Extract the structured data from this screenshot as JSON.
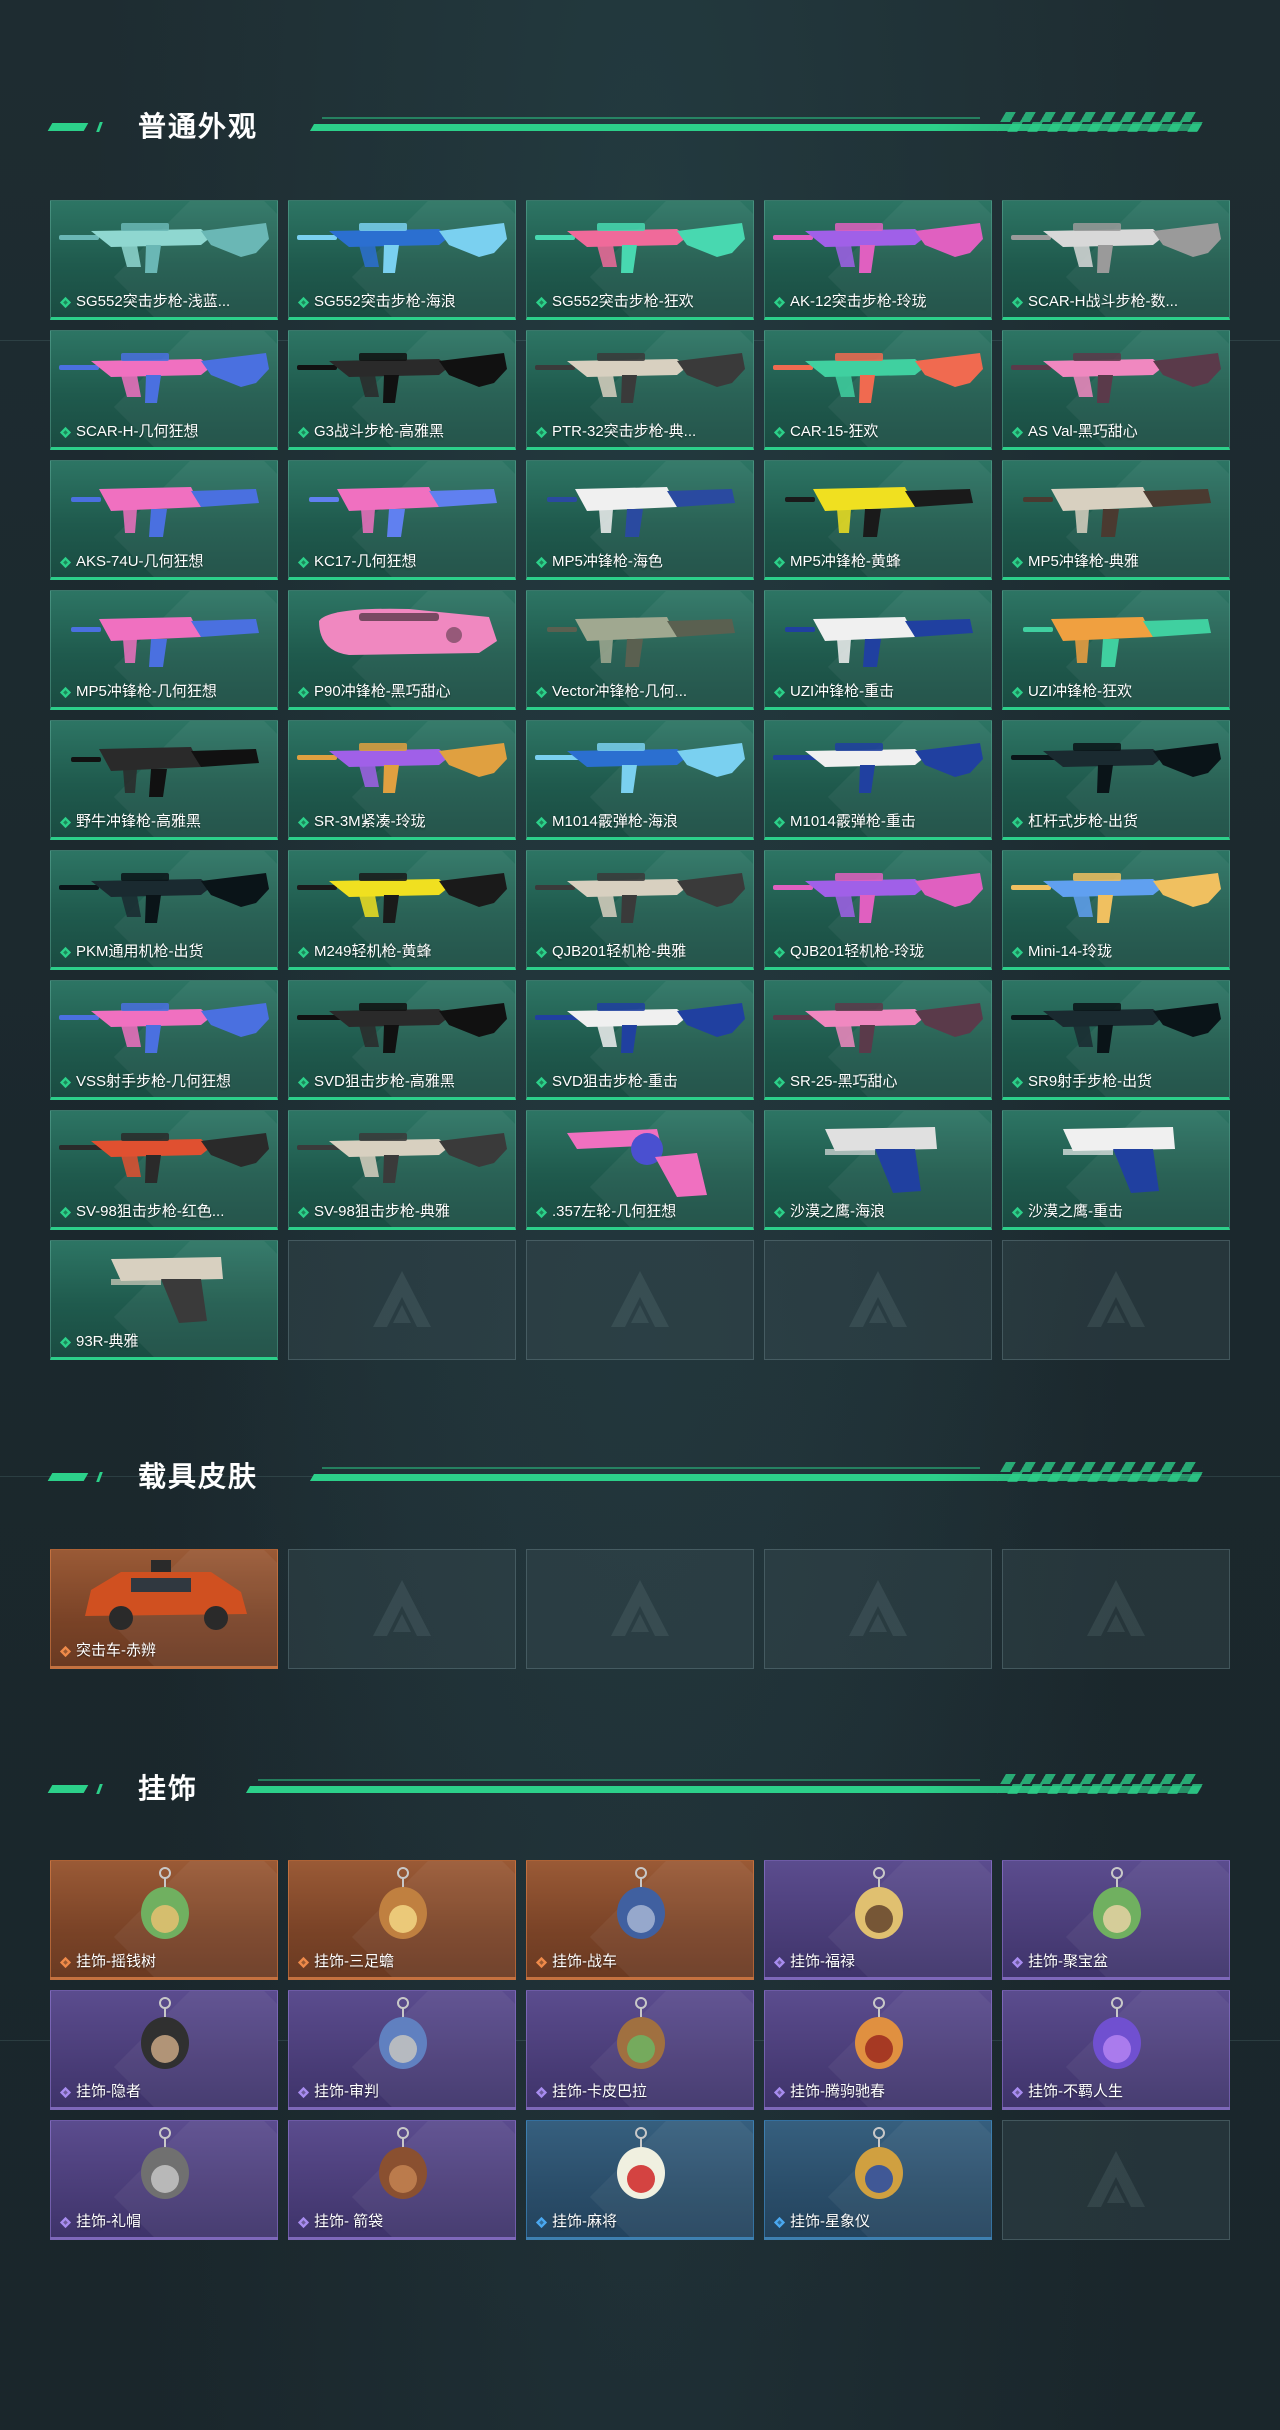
{
  "sections": [
    {
      "title": "普通外观",
      "items": [
        {
          "label": "SG552突击步枪-浅蓝...",
          "rarity": "green",
          "art": "rifle",
          "c1": "#8fd7d0",
          "c2": "#6ab7b5"
        },
        {
          "label": "SG552突击步枪-海浪",
          "rarity": "green",
          "art": "rifle",
          "c1": "#2b6fd0",
          "c2": "#7ad0f0"
        },
        {
          "label": "SG552突击步枪-狂欢",
          "rarity": "green",
          "art": "rifle",
          "c1": "#f06a9a",
          "c2": "#48d8b0"
        },
        {
          "label": "AK-12突击步枪-玲珑",
          "rarity": "green",
          "art": "rifle",
          "c1": "#a060e8",
          "c2": "#e060c0"
        },
        {
          "label": "SCAR-H战斗步枪-数...",
          "rarity": "green",
          "art": "rifle",
          "c1": "#d8d8d8",
          "c2": "#9a9a9a"
        },
        {
          "label": "SCAR-H-几何狂想",
          "rarity": "green",
          "art": "rifle",
          "c1": "#f070c0",
          "c2": "#4a70e0"
        },
        {
          "label": "G3战斗步枪-高雅黑",
          "rarity": "green",
          "art": "rifle",
          "c1": "#2a2a2a",
          "c2": "#111111"
        },
        {
          "label": "PTR-32突击步枪-典...",
          "rarity": "green",
          "art": "rifle",
          "c1": "#d8d0c0",
          "c2": "#3a3a3a"
        },
        {
          "label": "CAR-15-狂欢",
          "rarity": "green",
          "art": "rifle",
          "c1": "#40d0a0",
          "c2": "#f06a50"
        },
        {
          "label": "AS Val-黑巧甜心",
          "rarity": "green",
          "art": "rifle",
          "c1": "#f088c0",
          "c2": "#5a3a4a"
        },
        {
          "label": "AKS-74U-几何狂想",
          "rarity": "green",
          "art": "smg",
          "c1": "#f070c0",
          "c2": "#4a70e0"
        },
        {
          "label": "KC17-几何狂想",
          "rarity": "green",
          "art": "smg",
          "c1": "#f070c0",
          "c2": "#6080f0"
        },
        {
          "label": "MP5冲锋枪-海色",
          "rarity": "green",
          "art": "smg",
          "c1": "#f0f0f0",
          "c2": "#2a4aa0"
        },
        {
          "label": "MP5冲锋枪-黄蜂",
          "rarity": "green",
          "art": "smg",
          "c1": "#f0e020",
          "c2": "#1a1a1a"
        },
        {
          "label": "MP5冲锋枪-典雅",
          "rarity": "green",
          "art": "smg",
          "c1": "#d8d0c0",
          "c2": "#4a3a30"
        },
        {
          "label": "MP5冲锋枪-几何狂想",
          "rarity": "green",
          "art": "smg",
          "c1": "#f070c0",
          "c2": "#4a70e0"
        },
        {
          "label": "P90冲锋枪-黑巧甜心",
          "rarity": "green",
          "art": "p90",
          "c1": "#f088c0",
          "c2": "#5a3a4a"
        },
        {
          "label": "Vector冲锋枪-几何...",
          "rarity": "green",
          "art": "smg",
          "c1": "#a0a890",
          "c2": "#5a6050"
        },
        {
          "label": "UZI冲锋枪-重击",
          "rarity": "green",
          "art": "smg",
          "c1": "#f0f0f0",
          "c2": "#2040a0"
        },
        {
          "label": "UZI冲锋枪-狂欢",
          "rarity": "green",
          "art": "smg",
          "c1": "#f0a040",
          "c2": "#40d0a0"
        },
        {
          "label": "野牛冲锋枪-高雅黑",
          "rarity": "green",
          "art": "smg",
          "c1": "#2a2a2a",
          "c2": "#111111"
        },
        {
          "label": "SR-3M紧凑-玲珑",
          "rarity": "green",
          "art": "rifle",
          "c1": "#a060e8",
          "c2": "#e0a040"
        },
        {
          "label": "M1014霰弹枪-海浪",
          "rarity": "green",
          "art": "shotgun",
          "c1": "#2b6fd0",
          "c2": "#7ad0f0"
        },
        {
          "label": "M1014霰弹枪-重击",
          "rarity": "green",
          "art": "shotgun",
          "c1": "#f0f0f0",
          "c2": "#2040a0"
        },
        {
          "label": "杠杆式步枪-出货",
          "rarity": "green",
          "art": "shotgun",
          "c1": "#1a2a30",
          "c2": "#0a1418"
        },
        {
          "label": "PKM通用机枪-出货",
          "rarity": "green",
          "art": "lmg",
          "c1": "#1a2a30",
          "c2": "#0a1418"
        },
        {
          "label": "M249轻机枪-黄蜂",
          "rarity": "green",
          "art": "lmg",
          "c1": "#f0e020",
          "c2": "#1a1a1a"
        },
        {
          "label": "QJB201轻机枪-典雅",
          "rarity": "green",
          "art": "lmg",
          "c1": "#d8d0c0",
          "c2": "#3a3a3a"
        },
        {
          "label": "QJB201轻机枪-玲珑",
          "rarity": "green",
          "art": "lmg",
          "c1": "#a060e8",
          "c2": "#e060c0"
        },
        {
          "label": "Mini-14-玲珑",
          "rarity": "green",
          "art": "rifle",
          "c1": "#60a0f0",
          "c2": "#f0c060"
        },
        {
          "label": "VSS射手步枪-几何狂想",
          "rarity": "green",
          "art": "rifle",
          "c1": "#f070c0",
          "c2": "#4a70e0"
        },
        {
          "label": "SVD狙击步枪-高雅黑",
          "rarity": "green",
          "art": "sniper",
          "c1": "#2a2a2a",
          "c2": "#111111"
        },
        {
          "label": "SVD狙击步枪-重击",
          "rarity": "green",
          "art": "sniper",
          "c1": "#f0f0f0",
          "c2": "#2040a0"
        },
        {
          "label": "SR-25-黑巧甜心",
          "rarity": "green",
          "art": "rifle",
          "c1": "#f088c0",
          "c2": "#5a3a4a"
        },
        {
          "label": "SR9射手步枪-出货",
          "rarity": "green",
          "art": "sniper",
          "c1": "#1a2a30",
          "c2": "#0a1418"
        },
        {
          "label": "SV-98狙击步枪-红色...",
          "rarity": "green",
          "art": "sniper",
          "c1": "#e05030",
          "c2": "#2a2a2a"
        },
        {
          "label": "SV-98狙击步枪-典雅",
          "rarity": "green",
          "art": "sniper",
          "c1": "#d8d0c0",
          "c2": "#3a3a3a"
        },
        {
          "label": ".357左轮-几何狂想",
          "rarity": "green",
          "art": "revolver",
          "c1": "#f070c0",
          "c2": "#4a50d0"
        },
        {
          "label": "沙漠之鹰-海浪",
          "rarity": "green",
          "art": "pistol",
          "c1": "#e0e0e0",
          "c2": "#2040a0"
        },
        {
          "label": "沙漠之鹰-重击",
          "rarity": "green",
          "art": "pistol",
          "c1": "#f0f0f0",
          "c2": "#2040a0"
        },
        {
          "label": "93R-典雅",
          "rarity": "green",
          "art": "pistol",
          "c1": "#d8d0c0",
          "c2": "#3a3a3a"
        },
        {
          "label": "",
          "rarity": "empty"
        },
        {
          "label": "",
          "rarity": "empty"
        },
        {
          "label": "",
          "rarity": "empty"
        },
        {
          "label": "",
          "rarity": "empty"
        }
      ]
    },
    {
      "title": "载具皮肤",
      "items": [
        {
          "label": "突击车-赤辨",
          "rarity": "orange",
          "art": "vehicle",
          "c1": "#d05020",
          "c2": "#2a2a2a"
        },
        {
          "label": "",
          "rarity": "empty"
        },
        {
          "label": "",
          "rarity": "empty"
        },
        {
          "label": "",
          "rarity": "empty"
        },
        {
          "label": "",
          "rarity": "empty"
        }
      ]
    },
    {
      "title": "挂饰",
      "items": [
        {
          "label": "挂饰-摇钱树",
          "rarity": "orange",
          "art": "charm",
          "c1": "#70b060",
          "c2": "#e0c070"
        },
        {
          "label": "挂饰-三足蟾",
          "rarity": "orange",
          "art": "charm",
          "c1": "#c08040",
          "c2": "#f0d080"
        },
        {
          "label": "挂饰-战车",
          "rarity": "orange",
          "art": "charm",
          "c1": "#4060a0",
          "c2": "#a0b0d0"
        },
        {
          "label": "挂饰-福禄",
          "rarity": "purple",
          "art": "charm",
          "c1": "#e0c070",
          "c2": "#6a4a30"
        },
        {
          "label": "挂饰-聚宝盆",
          "rarity": "purple",
          "art": "charm",
          "c1": "#70b060",
          "c2": "#e0d0a0"
        },
        {
          "label": "挂饰-隐者",
          "rarity": "purple",
          "art": "charm",
          "c1": "#303030",
          "c2": "#c0a080"
        },
        {
          "label": "挂饰-审判",
          "rarity": "purple",
          "art": "charm",
          "c1": "#6080c0",
          "c2": "#c0c0c0"
        },
        {
          "label": "挂饰-卡皮巴拉",
          "rarity": "purple",
          "art": "charm",
          "c1": "#a07040",
          "c2": "#70b060"
        },
        {
          "label": "挂饰-腾驹驰春",
          "rarity": "purple",
          "art": "charm",
          "c1": "#e09040",
          "c2": "#a03020"
        },
        {
          "label": "挂饰-不羁人生",
          "rarity": "purple",
          "art": "charm",
          "c1": "#7050d0",
          "c2": "#b080f0"
        },
        {
          "label": "挂饰-礼帽",
          "rarity": "purple",
          "art": "charm",
          "c1": "#707070",
          "c2": "#c0c0c0"
        },
        {
          "label": "挂饰- 箭袋",
          "rarity": "purple",
          "art": "charm",
          "c1": "#8a5030",
          "c2": "#c08050"
        },
        {
          "label": "挂饰-麻将",
          "rarity": "blue",
          "art": "charm",
          "c1": "#f0f0e0",
          "c2": "#d03030"
        },
        {
          "label": "挂饰-星象仪",
          "rarity": "blue",
          "art": "charm",
          "c1": "#d0a040",
          "c2": "#3050a0"
        },
        {
          "label": "",
          "rarity": "empty"
        }
      ]
    }
  ],
  "rarity_colors": {
    "green": "#2cd08a",
    "orange": "#ef8a4a",
    "purple": "#a88cf0",
    "blue": "#4aa8f0"
  },
  "icons": {
    "rarity": "diamond-icon",
    "placeholder": "logo-placeholder-icon"
  }
}
